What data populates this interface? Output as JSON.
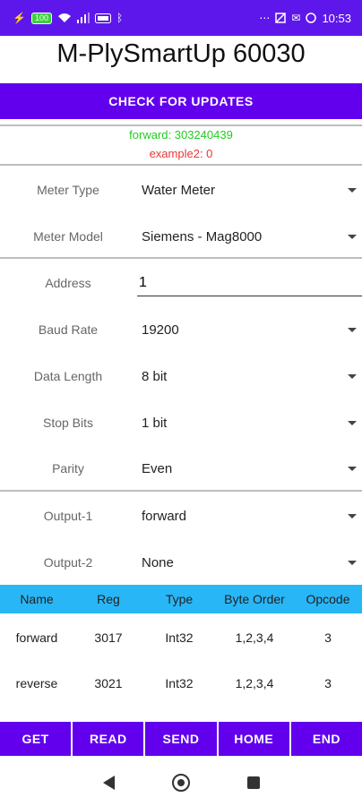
{
  "status_bar": {
    "battery_text": "100",
    "time": "10:53",
    "icons": [
      "charging-bolt-icon",
      "battery-icon",
      "wifi-icon",
      "signal-icon",
      "volte-icon",
      "bluetooth-icon",
      "dnd-icon",
      "mute-icon",
      "mail-icon",
      "whatsapp-icon"
    ]
  },
  "app": {
    "title": "M-PlySmartUp 60030",
    "check_updates_label": "CHECK FOR UPDATES",
    "status_line_1": "forward: 303240439",
    "status_line_2": "example2: 0"
  },
  "form": {
    "meter_type": {
      "label": "Meter Type",
      "value": "Water Meter"
    },
    "meter_model": {
      "label": "Meter Model",
      "value": "Siemens - Mag8000"
    },
    "address": {
      "label": "Address",
      "value": "1"
    },
    "baud_rate": {
      "label": "Baud Rate",
      "value": "19200"
    },
    "data_length": {
      "label": "Data Length",
      "value": "8 bit"
    },
    "stop_bits": {
      "label": "Stop Bits",
      "value": "1 bit"
    },
    "parity": {
      "label": "Parity",
      "value": "Even"
    },
    "output_1": {
      "label": "Output-1",
      "value": "forward"
    },
    "output_2": {
      "label": "Output-2",
      "value": "None"
    }
  },
  "table": {
    "headers": [
      "Name",
      "Reg",
      "Type",
      "Byte Order",
      "Opcode"
    ],
    "rows": [
      [
        "forward",
        "3017",
        "Int32",
        "1,2,3,4",
        "3"
      ],
      [
        "reverse",
        "3021",
        "Int32",
        "1,2,3,4",
        "3"
      ]
    ]
  },
  "bottom_buttons": [
    "GET",
    "READ",
    "SEND",
    "HOME",
    "END"
  ],
  "colors": {
    "primary": "#6200ee",
    "status_bar": "#5e17eb",
    "table_header": "#29b6f6",
    "status_green": "#22cc22",
    "status_red": "#e53935"
  }
}
